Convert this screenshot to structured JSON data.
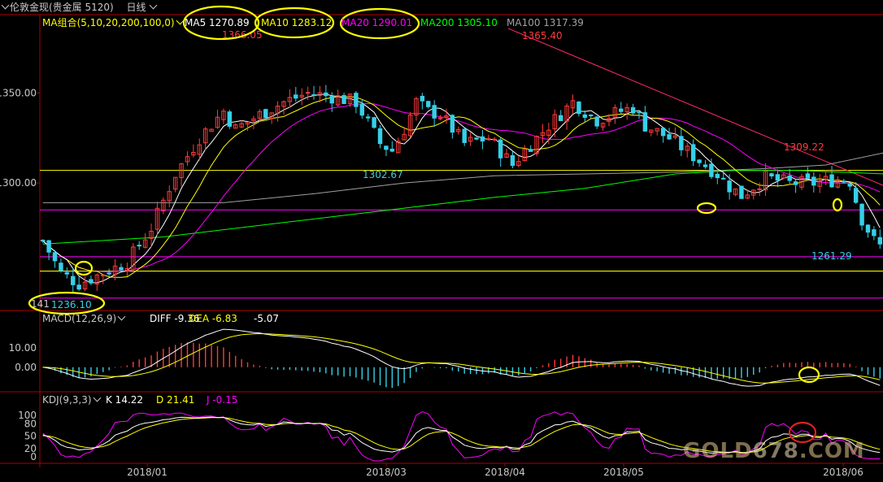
{
  "header": {
    "symbol": "伦敦金现(贵金属 5120)",
    "period": "日线"
  },
  "legends": {
    "ma_group": "MA组合(5,10,20,200,100,0)",
    "ma5": "MA5 1270.89",
    "ma10": "MA10 1283.12",
    "ma20": "MA20 1290.01",
    "ma200": "MA200 1305.10",
    "ma100": "MA100 1317.39",
    "macd": "MACD(12,26,9)",
    "diff": "DIFF -9.36",
    "dea": "DEA -6.83",
    "macd_val": "-5.07",
    "kdj": "KDJ(9,3,3)",
    "k": "K 14.22",
    "d": "D 21.41",
    "j": "J -0.15"
  },
  "colors": {
    "up": "#ff3a3a",
    "down": "#35d0e8",
    "ma5": "#ffffff",
    "ma10": "#ffff00",
    "ma20": "#ff00ff",
    "ma200": "#00ff00",
    "ma100": "#a0a0a0",
    "trend": "#ff2a6a",
    "highlight": "#ffff00"
  },
  "watermark": {
    "a": "GOLD",
    "b": "678",
    "c": ".COM"
  },
  "chart_data": {
    "type": "candlestick",
    "price_axis": {
      "ticks": [
        "1350.00",
        "1300.00"
      ],
      "ylim": [
        1230,
        1385
      ]
    },
    "time_axis": {
      "labels": [
        "2018/01",
        "2018/03",
        "2018/04",
        "2018/05",
        "2018/06"
      ]
    },
    "annotations": {
      "high1": "1366.05",
      "high2": "1365.40",
      "low_mid": "1302.67",
      "high3": "1309.22",
      "last_low": "1261.29",
      "low1": "1236.10",
      "low1_prefix": "141"
    },
    "horizontal_levels": [
      {
        "value": 1307.0,
        "color": "#ffff00"
      },
      {
        "value": 1285.0,
        "color": "#ff00ff"
      },
      {
        "value": 1259.0,
        "color": "#ff00ff"
      },
      {
        "value": 1251.0,
        "color": "#ffff00"
      },
      {
        "value": 1236.0,
        "color": "#ff00ff"
      }
    ],
    "ma100": [
      [
        0,
        1289
      ],
      [
        30,
        1289
      ],
      [
        45,
        1294
      ],
      [
        60,
        1300
      ],
      [
        75,
        1304
      ],
      [
        90,
        1305
      ],
      [
        105,
        1306
      ],
      [
        120,
        1308
      ],
      [
        130,
        1310
      ],
      [
        140,
        1317
      ]
    ],
    "ma200": [
      [
        0,
        1266
      ],
      [
        20,
        1270
      ],
      [
        40,
        1278
      ],
      [
        60,
        1286
      ],
      [
        75,
        1292
      ],
      [
        90,
        1297
      ],
      [
        105,
        1305
      ],
      [
        115,
        1307
      ],
      [
        125,
        1307
      ],
      [
        140,
        1305
      ]
    ],
    "macd_axis": {
      "ticks": [
        "10.00",
        "0.00"
      ],
      "ylim": [
        -12,
        22
      ]
    },
    "kdj_axis": {
      "ticks": [
        "100",
        "80",
        "50",
        "20",
        "0"
      ],
      "ylim": [
        -12,
        122
      ]
    }
  }
}
